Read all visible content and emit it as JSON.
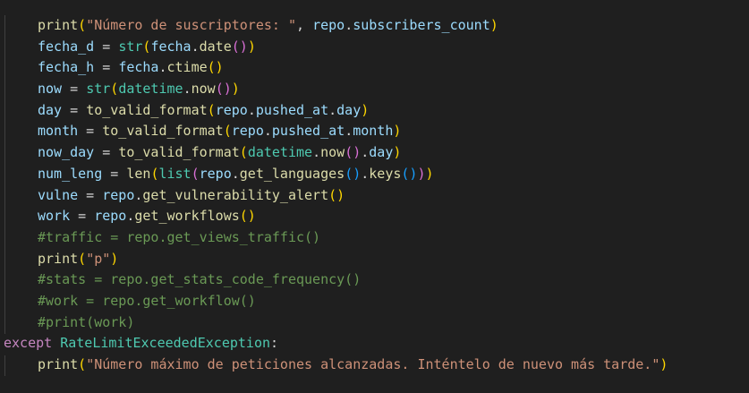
{
  "editor": {
    "lines": [
      {
        "indent": 1,
        "tokens": [
          [
            "fn",
            "print"
          ],
          [
            "b1",
            "("
          ],
          [
            "str",
            "\"Número de suscriptores: \""
          ],
          [
            "op",
            ", "
          ],
          [
            "var",
            "repo"
          ],
          [
            "op",
            "."
          ],
          [
            "var",
            "subscribers_count"
          ],
          [
            "b1",
            ")"
          ]
        ]
      },
      {
        "indent": 1,
        "tokens": [
          [
            "var",
            "fecha_d"
          ],
          [
            "op",
            " = "
          ],
          [
            "cls",
            "str"
          ],
          [
            "b1",
            "("
          ],
          [
            "var",
            "fecha"
          ],
          [
            "op",
            "."
          ],
          [
            "fn",
            "date"
          ],
          [
            "b2",
            "()"
          ],
          [
            "b1",
            ")"
          ]
        ]
      },
      {
        "indent": 1,
        "tokens": [
          [
            "var",
            "fecha_h"
          ],
          [
            "op",
            " = "
          ],
          [
            "var",
            "fecha"
          ],
          [
            "op",
            "."
          ],
          [
            "fn",
            "ctime"
          ],
          [
            "b1",
            "()"
          ]
        ]
      },
      {
        "indent": 1,
        "tokens": [
          [
            "var",
            "now"
          ],
          [
            "op",
            " = "
          ],
          [
            "cls",
            "str"
          ],
          [
            "b1",
            "("
          ],
          [
            "cls",
            "datetime"
          ],
          [
            "op",
            "."
          ],
          [
            "fn",
            "now"
          ],
          [
            "b2",
            "()"
          ],
          [
            "b1",
            ")"
          ]
        ]
      },
      {
        "indent": 1,
        "tokens": [
          [
            "var",
            "day"
          ],
          [
            "op",
            " = "
          ],
          [
            "fn",
            "to_valid_format"
          ],
          [
            "b1",
            "("
          ],
          [
            "var",
            "repo"
          ],
          [
            "op",
            "."
          ],
          [
            "var",
            "pushed_at"
          ],
          [
            "op",
            "."
          ],
          [
            "var",
            "day"
          ],
          [
            "b1",
            ")"
          ]
        ]
      },
      {
        "indent": 1,
        "tokens": [
          [
            "var",
            "month"
          ],
          [
            "op",
            " = "
          ],
          [
            "fn",
            "to_valid_format"
          ],
          [
            "b1",
            "("
          ],
          [
            "var",
            "repo"
          ],
          [
            "op",
            "."
          ],
          [
            "var",
            "pushed_at"
          ],
          [
            "op",
            "."
          ],
          [
            "var",
            "month"
          ],
          [
            "b1",
            ")"
          ]
        ]
      },
      {
        "indent": 1,
        "tokens": [
          [
            "var",
            "now_day"
          ],
          [
            "op",
            " = "
          ],
          [
            "fn",
            "to_valid_format"
          ],
          [
            "b1",
            "("
          ],
          [
            "cls",
            "datetime"
          ],
          [
            "op",
            "."
          ],
          [
            "fn",
            "now"
          ],
          [
            "b2",
            "()"
          ],
          [
            "op",
            "."
          ],
          [
            "var",
            "day"
          ],
          [
            "b1",
            ")"
          ]
        ]
      },
      {
        "indent": 1,
        "tokens": [
          [
            "var",
            "num_leng"
          ],
          [
            "op",
            " = "
          ],
          [
            "fn",
            "len"
          ],
          [
            "b1",
            "("
          ],
          [
            "cls",
            "list"
          ],
          [
            "b2",
            "("
          ],
          [
            "var",
            "repo"
          ],
          [
            "op",
            "."
          ],
          [
            "fn",
            "get_languages"
          ],
          [
            "b3",
            "()"
          ],
          [
            "op",
            "."
          ],
          [
            "fn",
            "keys"
          ],
          [
            "b3",
            "()"
          ],
          [
            "b2",
            ")"
          ],
          [
            "b1",
            ")"
          ]
        ]
      },
      {
        "indent": 1,
        "tokens": [
          [
            "var",
            "vulne"
          ],
          [
            "op",
            " = "
          ],
          [
            "var",
            "repo"
          ],
          [
            "op",
            "."
          ],
          [
            "fn",
            "get_vulnerability_alert"
          ],
          [
            "b1",
            "()"
          ]
        ]
      },
      {
        "indent": 1,
        "tokens": [
          [
            "var",
            "work"
          ],
          [
            "op",
            " = "
          ],
          [
            "var",
            "repo"
          ],
          [
            "op",
            "."
          ],
          [
            "fn",
            "get_workflows"
          ],
          [
            "b1",
            "()"
          ]
        ]
      },
      {
        "indent": 1,
        "tokens": [
          [
            "cm",
            "#traffic = repo.get_views_traffic()"
          ]
        ]
      },
      {
        "indent": 1,
        "tokens": [
          [
            "fn",
            "print"
          ],
          [
            "b1",
            "("
          ],
          [
            "str",
            "\"p\""
          ],
          [
            "b1",
            ")"
          ]
        ]
      },
      {
        "indent": 1,
        "tokens": [
          [
            "cm",
            "#stats = repo.get_stats_code_frequency()"
          ]
        ]
      },
      {
        "indent": 1,
        "tokens": [
          [
            "cm",
            "#work = repo.get_workflow()"
          ]
        ]
      },
      {
        "indent": 1,
        "tokens": [
          [
            "cm",
            "#print(work)"
          ]
        ]
      },
      {
        "indent": 0,
        "tokens": [
          [
            "kw",
            "except"
          ],
          [
            "op",
            " "
          ],
          [
            "cls",
            "RateLimitExceededException"
          ],
          [
            "op",
            ":"
          ]
        ]
      },
      {
        "indent": 1,
        "tokens": [
          [
            "fn",
            "print"
          ],
          [
            "b1",
            "("
          ],
          [
            "str",
            "\"Número máximo de peticiones alcanzadas. Inténtelo de nuevo más tarde.\""
          ],
          [
            "b1",
            ")"
          ]
        ]
      }
    ]
  },
  "colors": {
    "background": "#1f1f1f",
    "function": "#dcdcaa",
    "variable": "#9cdcfe",
    "string": "#ce9178",
    "class": "#4ec9b0",
    "keyword": "#c586c0",
    "comment": "#6a9955",
    "bracket_level1": "#ffd700",
    "bracket_level2": "#da70d6",
    "bracket_level3": "#179fff"
  }
}
